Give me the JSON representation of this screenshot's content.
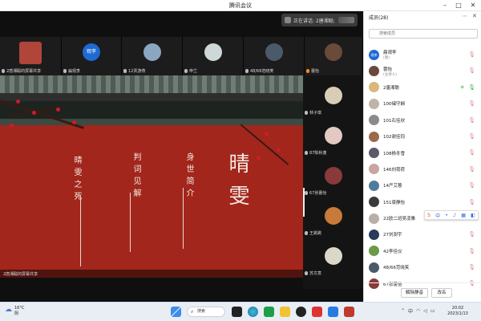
{
  "window": {
    "title": "腾讯会议"
  },
  "meeting": {
    "speaking": "正在讲话: 2唐湘聪;",
    "top_strip": [
      {
        "label": "2唐湘聪的屏幕共享",
        "color": "#b0453a"
      },
      {
        "label": "扁观李",
        "color": "#1e6ad1",
        "avatar_text": "观李"
      },
      {
        "label": "12贾游燕",
        "color": "#8aa6c0"
      },
      {
        "label": "申兰",
        "color": "#cfd8d8"
      },
      {
        "label": "48/66范晓笑",
        "color": "#4a5a6a"
      },
      {
        "label": "蕾怡",
        "color": "#6a4a3a"
      }
    ],
    "right_column": [
      {
        "label": "林子琪",
        "color": "#d9cdb8"
      },
      {
        "label": "87陈秋蓬",
        "color": "#e2c9c2"
      },
      {
        "label": "67张蕾怡",
        "color": "#8a3a3a"
      },
      {
        "label": "王跳跳",
        "color": "#c77a3a"
      },
      {
        "label": "苏文意",
        "color": "#dcd8c8"
      }
    ],
    "share_label": "2唐湘聪的屏幕共享",
    "slide": {
      "title": "晴雯",
      "sec1": "身世简介",
      "sec2": "判词见解",
      "sec3": "晴雯之死"
    }
  },
  "panel": {
    "title": "成员(28)",
    "search_placeholder": "搜索成员",
    "members": [
      {
        "name": "扁观李",
        "sub": "(我)",
        "color": "#1e6ad1",
        "avatar_text": "观李"
      },
      {
        "name": "蕾怡",
        "sub": "(主持人)",
        "color": "#6a4a3a"
      },
      {
        "name": "2唐湘聪",
        "color": "#d9b87a"
      },
      {
        "name": "100储守娴",
        "color": "#c0b3a8"
      },
      {
        "name": "101石佳欣",
        "color": "#8a8a8a"
      },
      {
        "name": "102谢佳钧",
        "color": "#9b6a4a"
      },
      {
        "name": "108杨冬雪",
        "color": "#5a5a6a"
      },
      {
        "name": "146刘荷荷",
        "color": "#c9a4a0"
      },
      {
        "name": "14严艾蓉",
        "color": "#4f7c9c"
      },
      {
        "name": "151梁静怡",
        "color": "#3a3a3a"
      },
      {
        "name": "22欧二班吴凌雅",
        "color": "#b8b0a8"
      },
      {
        "name": "27刘澍宇",
        "color": "#2a3a5a"
      },
      {
        "name": "42李佳仪",
        "color": "#6a9a4a"
      },
      {
        "name": "48/66范晓笑",
        "color": "#4a5a6a"
      },
      {
        "name": "67张蕾怡",
        "color": "#8a3a3a"
      }
    ],
    "unmute_button": "解除静音",
    "rename_button": "改名"
  },
  "taskbar": {
    "temp": "16°C",
    "weather": "阴",
    "search": "搜索",
    "time": "20:02",
    "date": "2023/1/13"
  }
}
